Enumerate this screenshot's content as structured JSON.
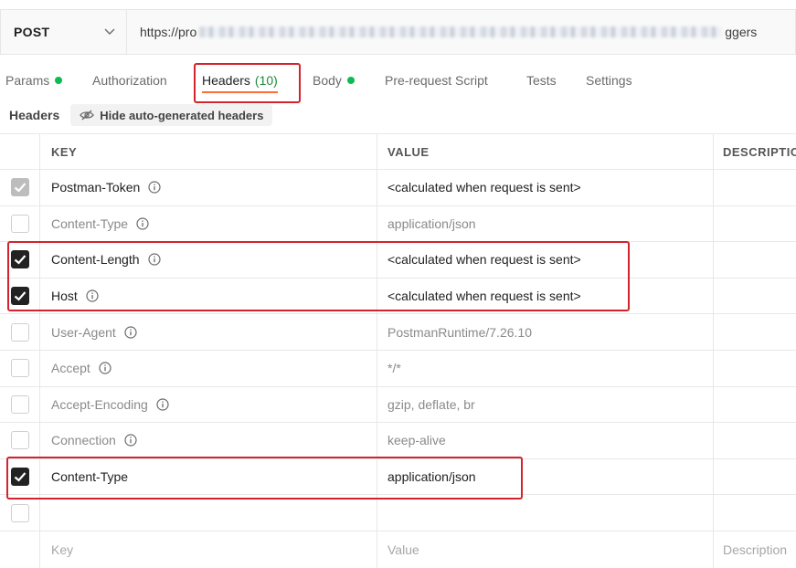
{
  "request": {
    "method": "POST",
    "url_start": "https://pro",
    "url_end": "ggers"
  },
  "tabs": [
    {
      "label": "Params",
      "dot": true
    },
    {
      "label": "Authorization"
    },
    {
      "label": "Headers",
      "count": "(10)"
    },
    {
      "label": "Body",
      "dot": true
    },
    {
      "label": "Pre-request Script"
    },
    {
      "label": "Tests"
    },
    {
      "label": "Settings"
    }
  ],
  "headers_bar": {
    "title": "Headers",
    "hide_button": "Hide auto-generated headers"
  },
  "table": {
    "columns": [
      "KEY",
      "VALUE",
      "DESCRIPTIO"
    ],
    "rows": [
      {
        "key": "Postman-Token",
        "value": "<calculated when request is sent>",
        "checked": "gray"
      },
      {
        "key": "Content-Type",
        "value": "application/json",
        "checked": "off"
      },
      {
        "key": "Content-Length",
        "value": "<calculated when request is sent>",
        "checked": "on"
      },
      {
        "key": "Host",
        "value": "<calculated when request is sent>",
        "checked": "on"
      },
      {
        "key": "User-Agent",
        "value": "PostmanRuntime/7.26.10",
        "checked": "off"
      },
      {
        "key": "Accept",
        "value": "*/*",
        "checked": "off"
      },
      {
        "key": "Accept-Encoding",
        "value": "gzip, deflate, br",
        "checked": "off"
      },
      {
        "key": "Connection",
        "value": "keep-alive",
        "checked": "off"
      },
      {
        "key": "Content-Type",
        "value": "application/json",
        "checked": "on"
      }
    ],
    "placeholders": {
      "key": "Key",
      "value": "Value",
      "description": "Description"
    }
  },
  "colors": {
    "accent": "#ff6c37",
    "highlight": "#d4232c",
    "dot": "#0cbb52"
  }
}
